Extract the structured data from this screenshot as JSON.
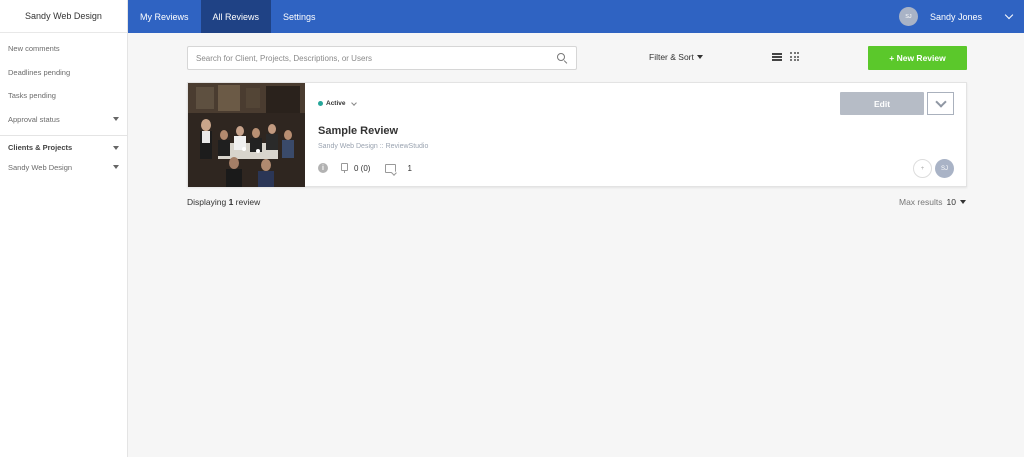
{
  "sidebar": {
    "brand": "Sandy Web Design",
    "items": [
      {
        "label": "New comments"
      },
      {
        "label": "Deadlines pending"
      },
      {
        "label": "Tasks pending"
      },
      {
        "label": "Approval status"
      },
      {
        "label": "Clients & Projects"
      },
      {
        "label": "Sandy Web Design"
      }
    ]
  },
  "topnav": {
    "tabs": [
      {
        "label": "My Reviews"
      },
      {
        "label": "All Reviews",
        "active": true
      },
      {
        "label": "Settings"
      }
    ],
    "user": {
      "initials": "SJ",
      "name": "Sandy Jones"
    }
  },
  "toolbar": {
    "search_placeholder": "Search for Client, Projects, Descriptions, or Users",
    "filter_label": "Filter & Sort",
    "new_review_label": "+ New Review"
  },
  "review": {
    "status": "Active",
    "title": "Sample Review",
    "subtitle": "Sandy Web Design :: ReviewStudio",
    "info_glyph": "i",
    "pins": "0 (0)",
    "comments": "1",
    "edit_label": "Edit",
    "add_glyph": "+",
    "avatar_initials": "SJ"
  },
  "footer": {
    "displaying_prefix": "Displaying ",
    "displaying_count": "1",
    "displaying_suffix": " review",
    "max_results_label": "Max results",
    "max_results_value": "10"
  },
  "colors": {
    "nav_blue": "#2f63c2",
    "nav_active": "#1f4285",
    "new_review_green": "#5bc82b",
    "status_dot": "#26a69a",
    "edit_gray": "#b6bcc6"
  }
}
